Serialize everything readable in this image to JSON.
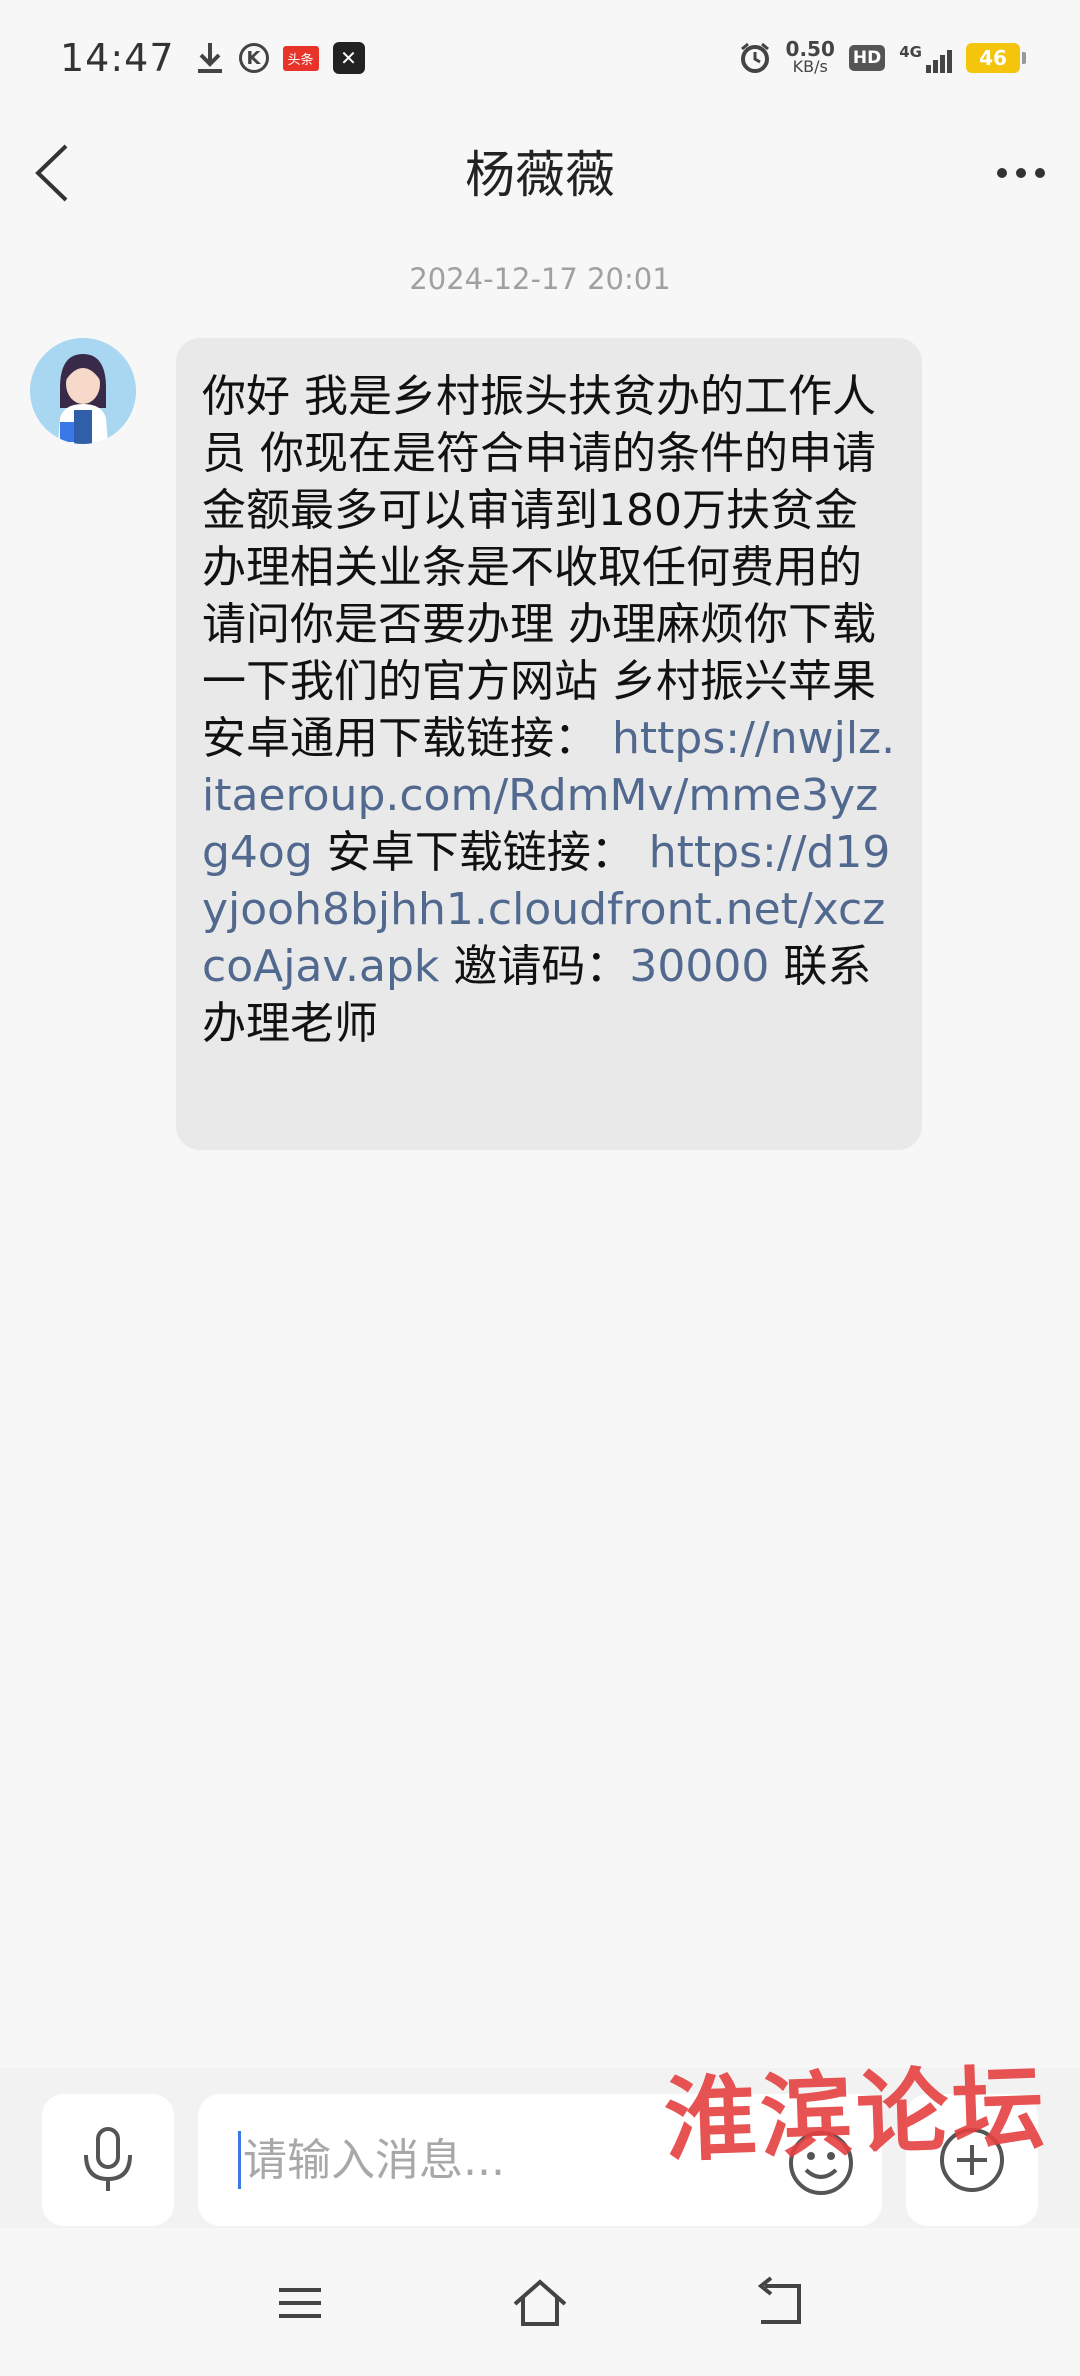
{
  "status_bar": {
    "time": "14:47",
    "toutiao_label": "头条",
    "network_speed_value": "0.50",
    "network_speed_unit": "KB/s",
    "hd_label": "HD",
    "network_type": "4G",
    "battery_level": "46"
  },
  "header": {
    "contact_name": "杨薇薇"
  },
  "conversation": {
    "timestamp": "2024-12-17 20:01",
    "message": {
      "text_part1": "你好 我是乡村振头扶贫办的工作人员 你现在是符合申请的条件的申请金额最多可以审请到180万扶贫金 办理相关业条是不收取任何费用的 请问你是否要办理  办理麻烦你下载一下我们的官方网站 乡村振兴苹果安卓通用下载链接：",
      "link1": "https://nwjlz.itaeroup.com/RdmMv/mme3yzg4og",
      "text_part2": "安卓下载链接：",
      "link2": "https://d19yjooh8bjhh1.cloudfront.net/xczcoAjav.apk",
      "text_part3": "邀请码：",
      "invite_code": "30000",
      "text_part4": "联系办理老师"
    }
  },
  "input_bar": {
    "placeholder": "请输入消息..."
  },
  "watermark": "淮滨论坛",
  "icons": {
    "status": [
      "download-icon",
      "k-app-icon",
      "toutiao-icon",
      "capcut-icon",
      "alarm-icon",
      "hd-icon",
      "signal-icon",
      "battery-icon"
    ],
    "header": [
      "back-arrow-icon",
      "more-dots-icon"
    ],
    "input": [
      "microphone-icon",
      "emoji-icon",
      "plus-icon"
    ],
    "nav": [
      "menu-icon",
      "home-icon",
      "back-icon"
    ]
  },
  "colors": {
    "background": "#f7f7f7",
    "bubble": "#e9e9e9",
    "link": "#51688f",
    "watermark": "#e54040",
    "battery": "#f5c40c"
  }
}
